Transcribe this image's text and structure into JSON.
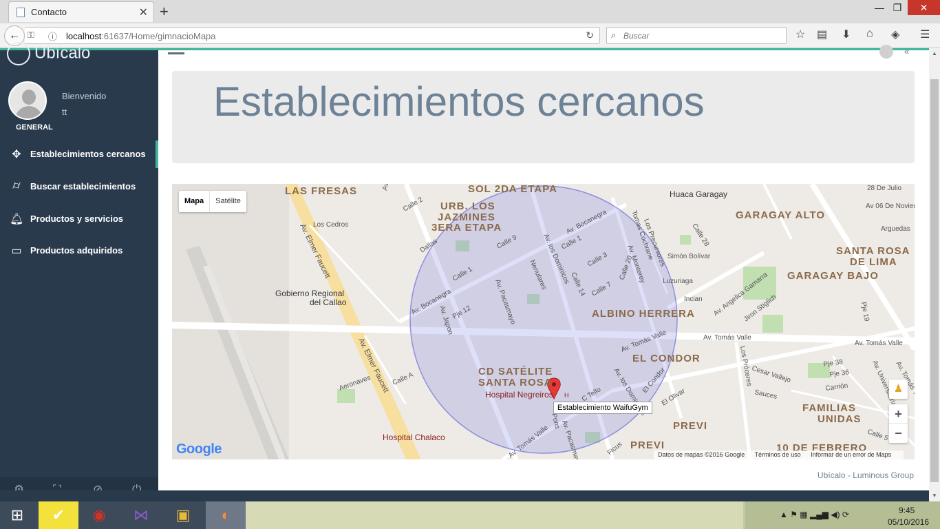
{
  "browser": {
    "tab_title": "Contacto",
    "url_host": "localhost",
    "url_path": ":61637/Home/gimnacioMapa",
    "search_placeholder": "Buscar"
  },
  "sidebar": {
    "brand": "Ubícalo",
    "user_role": "GENERAL",
    "welcome_label": "Bienvenido",
    "username": "tt",
    "items": [
      {
        "label": "Establecimientos cercanos",
        "icon": "crosshair-icon",
        "active": true
      },
      {
        "label": "Buscar establecimientos",
        "icon": "binoculars-icon",
        "active": false
      },
      {
        "label": "Productos y servicios",
        "icon": "bell-icon",
        "active": false
      },
      {
        "label": "Productos adquiridos",
        "icon": "credit-card-icon",
        "active": false
      }
    ],
    "footer_icons": [
      "gear-icon",
      "fullscreen-icon",
      "eye-slash-icon",
      "power-icon"
    ]
  },
  "main": {
    "page_title": "Establecimientos cercanos",
    "footer": "Ubícalo - Luminous Group"
  },
  "map": {
    "type_buttons": [
      "Mapa",
      "Satélite"
    ],
    "selected_type": "Mapa",
    "marker_label": "Establecimiento WaifuGym",
    "zoom_in": "+",
    "zoom_out": "−",
    "logo": "Google",
    "credits": [
      "Datos de mapas ©2016 Google",
      "Términos de uso",
      "Informar de un error de Maps"
    ],
    "labels": {
      "las_fresas": "LAS FRESAS",
      "sol_2da_etapa": "SOL 2DA ETAPA",
      "urb_los": "URB. LOS",
      "jazmines": "JAZMINES",
      "3era_etapa": "3ERA ETAPA",
      "huaca_garagay": "Huaca Garagay",
      "28_de_julio": "28 De Julio",
      "av_06_noviembre": "Av 06 De Noviembr",
      "garagay_alto": "GARAGAY ALTO",
      "arguedas": "Arguedas",
      "santa_rosa": "SANTA ROSA",
      "de_lima": "DE LIMA",
      "garagay_bajo": "GARAGAY BAJO",
      "gobierno_regional": "Gobierno Regional",
      "del_callao": "del Callao",
      "albino_herrera": "ALBINO HERRERA",
      "el_condor": "EL CONDOR",
      "cd_satelite": "CD SATÉLITE",
      "santa_rosa_2": "SANTA ROSA",
      "hospital_negreiros": "Hospital Negreiros",
      "hospital_chalaco": "Hospital Chalaco",
      "previ": "PREVI",
      "previ_2": "PREVI",
      "familias": "FAMILIAS",
      "unidas": "UNIDAS",
      "10_de_febrero": "10 DE FEBRERO",
      "av_elmer_faucett": "Av. Elmer Faucett",
      "av_elmer_faucett_2": "Av. Elmer Faucett",
      "av_japon": "Av. Japon",
      "av_japon_2": "Av. Japon",
      "calle_2": "Calle 2",
      "los_cedros": "Los Cedros",
      "dallas": "Dallas",
      "calle_9": "Calle 9",
      "av_bocanegra": "Av. Bocanegra",
      "av_bocanegra_2": "Av. Bocanegra",
      "calle_1": "Calle 1",
      "calle_1_2": "Calle 1",
      "av_los_dominicos": "Av. los Dominicos",
      "av_pacasmayo": "Av. Pacasmayo",
      "nenufares": "Nenufares",
      "calle_14": "Calle 14",
      "calle_3": "Calle 3",
      "calle_7": "Calle 7",
      "calle_20": "Calle 20",
      "pje_12": "Pje 12",
      "tomas_cochrane": "Tomas Cochrane",
      "av_monterey": "Av. Monterey",
      "los_precursores": "Los Precursores",
      "simon_bolivar": "Simón Bolívar",
      "luzuriaga": "Luzuriaga",
      "incian": "Incian",
      "av_angelica_gamarra": "Av. Angelica Gamarra",
      "jiron_stiglich": "Jiron Stiglich",
      "av_tomas_valle": "Av. Tomás Valle",
      "av_tomas_valle_2": "Av. Tomás Valle",
      "av_tomas_valle_3": "Av. Tomás Valle",
      "av_tomas_valle_4": "Av. Tomás Valle",
      "av_tomas_valle_5": "Av. Tomás Valle",
      "aeronaves": "Aeronaves",
      "calle_a": "Calle A",
      "c_tello": "C Tello",
      "el_condor_st": "El Condor",
      "el_olivar": "El Olivar",
      "los_proceres": "Los Próceres",
      "cesar_vallejo": "Cesar Vallejo",
      "sauces": "Sauces",
      "pje_38": "Pje 38",
      "pje_36": "Pje 36",
      "carrion": "Carrión",
      "av_universitaria": "Av. Universitaria",
      "pje_19": "Pje 19",
      "calle_28": "Calle 28",
      "ficus": "Ficus",
      "av_pacasmayo_2": "Av. Pacasmayo",
      "pons": "Pons",
      "av_los_dominicos_2": "Av. los Dominicos",
      "calle_5": "Calle 5",
      "h": "H"
    }
  },
  "taskbar": {
    "time": "9:45",
    "date": "05/10/2016"
  },
  "colors": {
    "sidebar_bg": "#2a3a4d",
    "accent": "#3fb59a",
    "title_color": "#6d8296",
    "circle_fill": "#6a6ee0",
    "marker": "#e53935"
  }
}
